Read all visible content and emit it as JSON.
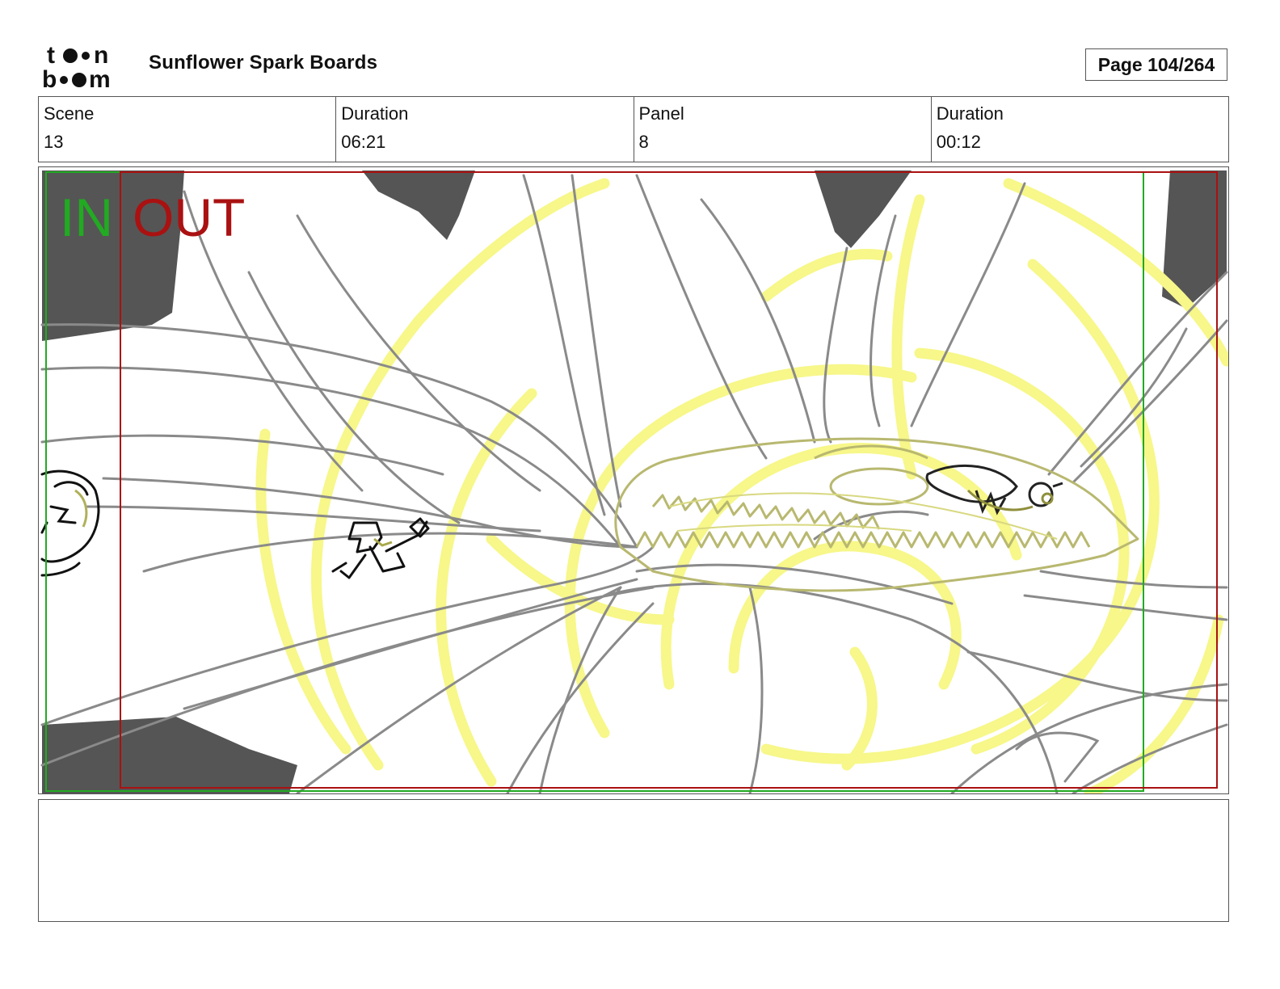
{
  "header": {
    "logo_text": "toonboom",
    "board_title": "Sunflower Spark Boards",
    "page_label": "Page 104/264"
  },
  "info": {
    "scene_label": "Scene",
    "scene_value": "13",
    "scene_duration_label": "Duration",
    "scene_duration_value": "06:21",
    "panel_label": "Panel",
    "panel_value": "8",
    "panel_duration_label": "Duration",
    "panel_duration_value": "00:12"
  },
  "panel": {
    "in_label": "IN",
    "out_label": "OUT",
    "colors": {
      "in": "#22aa22",
      "out": "#aa1111",
      "sketch_gray": "#8a8a8a",
      "sketch_yellow": "#f7f78a",
      "shadow": "#555555"
    }
  },
  "notes": {
    "text": ""
  }
}
